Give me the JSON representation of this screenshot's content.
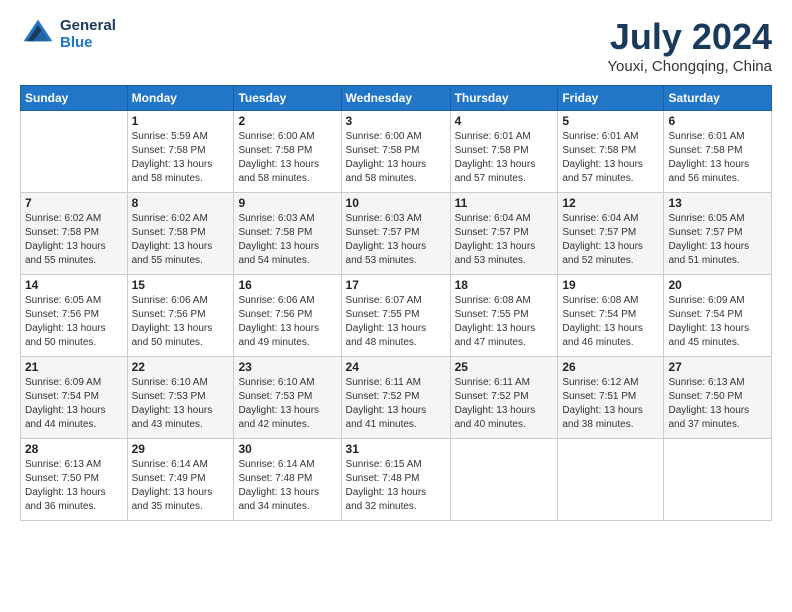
{
  "header": {
    "logo_line1": "General",
    "logo_line2": "Blue",
    "month": "July 2024",
    "location": "Youxi, Chongqing, China"
  },
  "weekdays": [
    "Sunday",
    "Monday",
    "Tuesday",
    "Wednesday",
    "Thursday",
    "Friday",
    "Saturday"
  ],
  "weeks": [
    [
      {
        "day": "",
        "info": ""
      },
      {
        "day": "1",
        "info": "Sunrise: 5:59 AM\nSunset: 7:58 PM\nDaylight: 13 hours\nand 58 minutes."
      },
      {
        "day": "2",
        "info": "Sunrise: 6:00 AM\nSunset: 7:58 PM\nDaylight: 13 hours\nand 58 minutes."
      },
      {
        "day": "3",
        "info": "Sunrise: 6:00 AM\nSunset: 7:58 PM\nDaylight: 13 hours\nand 58 minutes."
      },
      {
        "day": "4",
        "info": "Sunrise: 6:01 AM\nSunset: 7:58 PM\nDaylight: 13 hours\nand 57 minutes."
      },
      {
        "day": "5",
        "info": "Sunrise: 6:01 AM\nSunset: 7:58 PM\nDaylight: 13 hours\nand 57 minutes."
      },
      {
        "day": "6",
        "info": "Sunrise: 6:01 AM\nSunset: 7:58 PM\nDaylight: 13 hours\nand 56 minutes."
      }
    ],
    [
      {
        "day": "7",
        "info": "Sunrise: 6:02 AM\nSunset: 7:58 PM\nDaylight: 13 hours\nand 55 minutes."
      },
      {
        "day": "8",
        "info": "Sunrise: 6:02 AM\nSunset: 7:58 PM\nDaylight: 13 hours\nand 55 minutes."
      },
      {
        "day": "9",
        "info": "Sunrise: 6:03 AM\nSunset: 7:58 PM\nDaylight: 13 hours\nand 54 minutes."
      },
      {
        "day": "10",
        "info": "Sunrise: 6:03 AM\nSunset: 7:57 PM\nDaylight: 13 hours\nand 53 minutes."
      },
      {
        "day": "11",
        "info": "Sunrise: 6:04 AM\nSunset: 7:57 PM\nDaylight: 13 hours\nand 53 minutes."
      },
      {
        "day": "12",
        "info": "Sunrise: 6:04 AM\nSunset: 7:57 PM\nDaylight: 13 hours\nand 52 minutes."
      },
      {
        "day": "13",
        "info": "Sunrise: 6:05 AM\nSunset: 7:57 PM\nDaylight: 13 hours\nand 51 minutes."
      }
    ],
    [
      {
        "day": "14",
        "info": "Sunrise: 6:05 AM\nSunset: 7:56 PM\nDaylight: 13 hours\nand 50 minutes."
      },
      {
        "day": "15",
        "info": "Sunrise: 6:06 AM\nSunset: 7:56 PM\nDaylight: 13 hours\nand 50 minutes."
      },
      {
        "day": "16",
        "info": "Sunrise: 6:06 AM\nSunset: 7:56 PM\nDaylight: 13 hours\nand 49 minutes."
      },
      {
        "day": "17",
        "info": "Sunrise: 6:07 AM\nSunset: 7:55 PM\nDaylight: 13 hours\nand 48 minutes."
      },
      {
        "day": "18",
        "info": "Sunrise: 6:08 AM\nSunset: 7:55 PM\nDaylight: 13 hours\nand 47 minutes."
      },
      {
        "day": "19",
        "info": "Sunrise: 6:08 AM\nSunset: 7:54 PM\nDaylight: 13 hours\nand 46 minutes."
      },
      {
        "day": "20",
        "info": "Sunrise: 6:09 AM\nSunset: 7:54 PM\nDaylight: 13 hours\nand 45 minutes."
      }
    ],
    [
      {
        "day": "21",
        "info": "Sunrise: 6:09 AM\nSunset: 7:54 PM\nDaylight: 13 hours\nand 44 minutes."
      },
      {
        "day": "22",
        "info": "Sunrise: 6:10 AM\nSunset: 7:53 PM\nDaylight: 13 hours\nand 43 minutes."
      },
      {
        "day": "23",
        "info": "Sunrise: 6:10 AM\nSunset: 7:53 PM\nDaylight: 13 hours\nand 42 minutes."
      },
      {
        "day": "24",
        "info": "Sunrise: 6:11 AM\nSunset: 7:52 PM\nDaylight: 13 hours\nand 41 minutes."
      },
      {
        "day": "25",
        "info": "Sunrise: 6:11 AM\nSunset: 7:52 PM\nDaylight: 13 hours\nand 40 minutes."
      },
      {
        "day": "26",
        "info": "Sunrise: 6:12 AM\nSunset: 7:51 PM\nDaylight: 13 hours\nand 38 minutes."
      },
      {
        "day": "27",
        "info": "Sunrise: 6:13 AM\nSunset: 7:50 PM\nDaylight: 13 hours\nand 37 minutes."
      }
    ],
    [
      {
        "day": "28",
        "info": "Sunrise: 6:13 AM\nSunset: 7:50 PM\nDaylight: 13 hours\nand 36 minutes."
      },
      {
        "day": "29",
        "info": "Sunrise: 6:14 AM\nSunset: 7:49 PM\nDaylight: 13 hours\nand 35 minutes."
      },
      {
        "day": "30",
        "info": "Sunrise: 6:14 AM\nSunset: 7:48 PM\nDaylight: 13 hours\nand 34 minutes."
      },
      {
        "day": "31",
        "info": "Sunrise: 6:15 AM\nSunset: 7:48 PM\nDaylight: 13 hours\nand 32 minutes."
      },
      {
        "day": "",
        "info": ""
      },
      {
        "day": "",
        "info": ""
      },
      {
        "day": "",
        "info": ""
      }
    ]
  ]
}
